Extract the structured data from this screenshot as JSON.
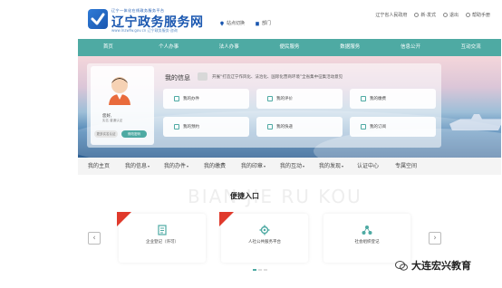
{
  "header": {
    "logo_top": "辽宁一体化在线政务服务平台",
    "logo_title": "辽宁政务服务网",
    "logo_url": "www.lnzwfw.gov.cn 辽宁政务服务·咨询",
    "location": "站点切换",
    "department": "部门",
    "top_links": [
      "辽宁省人民政府",
      "新·发式",
      "退出",
      "帮助手册"
    ]
  },
  "main_nav": [
    "首页",
    "个人办事",
    "法人办事",
    "便民服务",
    "数据服务",
    "信息公开",
    "互动交流"
  ],
  "profile": {
    "greeting": "您好,",
    "user_sub": "实名 普通认证",
    "button_left": "更多实名认证",
    "button_right": "修改密码"
  },
  "info": {
    "title": "我的信息",
    "desc": "开展“打造辽宁作风化、法治化、国际化营商环境”全省集中征集活动意见"
  },
  "cards": [
    "我的办件",
    "我的评价",
    "我的缴费",
    "我的预约",
    "我的快递",
    "我的订阅"
  ],
  "sub_nav": [
    {
      "label": "我的主页",
      "caret": false
    },
    {
      "label": "我的信息",
      "caret": true
    },
    {
      "label": "我的办件",
      "caret": true
    },
    {
      "label": "我的缴费",
      "caret": false
    },
    {
      "label": "我的印章",
      "caret": true
    },
    {
      "label": "我的互动",
      "caret": true
    },
    {
      "label": "我的发现",
      "caret": true
    },
    {
      "label": "认证中心",
      "caret": false
    },
    {
      "label": "专属空间",
      "caret": false
    }
  ],
  "caret_glyph": "▾",
  "section": {
    "watermark": "BIAN JIE RU KOU",
    "title": "便捷入口"
  },
  "entrances": [
    {
      "label": "企业登记（许可）",
      "icon": "document-icon",
      "ribbon": true
    },
    {
      "label": "人社公共服务平台",
      "icon": "gear-icon",
      "ribbon": true
    },
    {
      "label": "社会组织登记",
      "icon": "network-icon",
      "ribbon": false
    }
  ],
  "arrows": {
    "prev": "‹",
    "next": "›"
  },
  "watermark_text": "大连宏兴教育",
  "colors": {
    "nav_teal": "#4eaaa3",
    "brand_blue": "#1a57b0",
    "ribbon_red": "#e03a2c"
  }
}
